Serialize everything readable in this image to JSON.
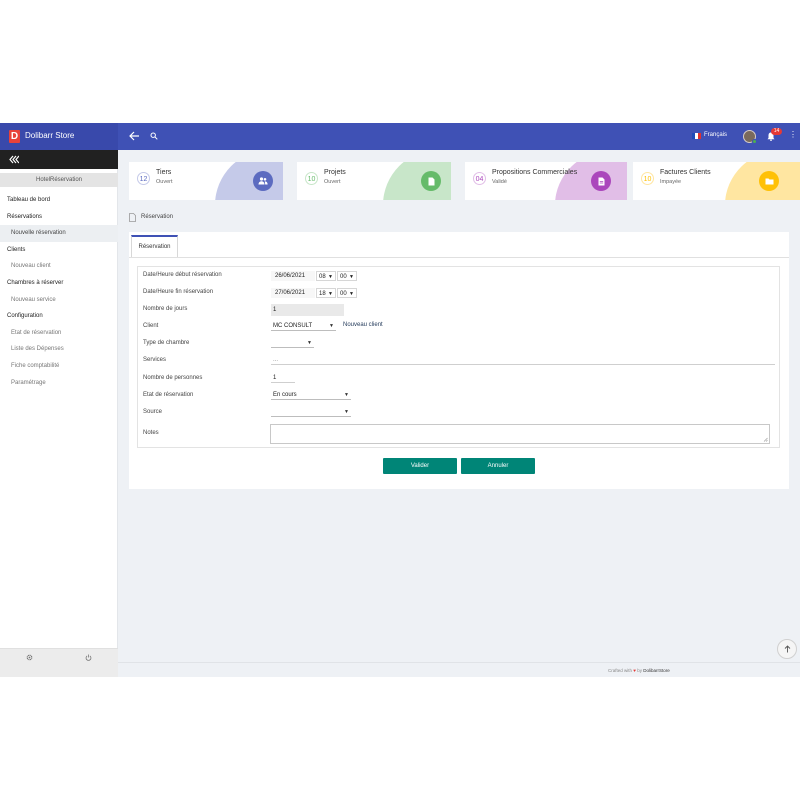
{
  "header": {
    "brand": "Dolibarr Store",
    "logo_letter": "D",
    "language": "Français",
    "notification_count": "14"
  },
  "sidebar": {
    "module_title": "HotelRéservation",
    "items": [
      {
        "label": "Tableau de bord",
        "type": "heading"
      },
      {
        "label": "Réservations",
        "type": "heading"
      },
      {
        "label": "Nouvelle réservation",
        "type": "sub",
        "active": true
      },
      {
        "label": "Clients",
        "type": "heading"
      },
      {
        "label": "Nouveau client",
        "type": "sub"
      },
      {
        "label": "Chambres à réserver",
        "type": "heading"
      },
      {
        "label": "Nouveau service",
        "type": "sub"
      },
      {
        "label": "Configuration",
        "type": "heading"
      },
      {
        "label": "Etat de réservation",
        "type": "sub"
      },
      {
        "label": "Liste des Dépenses",
        "type": "sub"
      },
      {
        "label": "Fiche comptabilité",
        "type": "sub"
      },
      {
        "label": "Paramétrage",
        "type": "sub"
      }
    ]
  },
  "cards": [
    {
      "number": "12",
      "title": "Tiers",
      "subtitle": "Ouvert",
      "color": "#5c6bc0",
      "blob": "#c5cae9",
      "icon": "users-icon"
    },
    {
      "number": "10",
      "title": "Projets",
      "subtitle": "Ouvert",
      "color": "#66bb6a",
      "blob": "#c8e6c9",
      "icon": "document-icon"
    },
    {
      "number": "04",
      "title": "Propositions Commerciales",
      "subtitle": "Validé",
      "color": "#ab47bc",
      "blob": "#e1bee7",
      "icon": "file-text-icon"
    },
    {
      "number": "10",
      "title": "Factures Clients",
      "subtitle": "Impayée",
      "color": "#ffc107",
      "blob": "#ffe6a1",
      "icon": "folder-icon"
    }
  ],
  "page": {
    "title": "Réservation",
    "tab": "Réservation"
  },
  "form": {
    "start_label": "Date/Heure début réservation",
    "start_date": "26/06/2021",
    "start_hour": "08",
    "start_min": "00",
    "end_label": "Date/Heure fin réservation",
    "end_date": "27/06/2021",
    "end_hour": "18",
    "end_min": "00",
    "days_label": "Nombre de jours",
    "days_value": "1",
    "client_label": "Client",
    "client_value": "MC CONSULT",
    "new_client_link": "Nouveau client",
    "room_type_label": "Type de chambre",
    "room_type_value": "",
    "services_label": "Services",
    "services_value": "...",
    "persons_label": "Nombre de personnes",
    "persons_value": "1",
    "status_label": "Etat de réservation",
    "status_value": "En cours",
    "source_label": "Source",
    "source_value": "",
    "notes_label": "Notes",
    "notes_value": ""
  },
  "buttons": {
    "validate": "Valider",
    "cancel": "Annuler"
  },
  "footer": {
    "prefix": "Crafted with",
    "by": "by",
    "brand": "DolibarrStore"
  }
}
